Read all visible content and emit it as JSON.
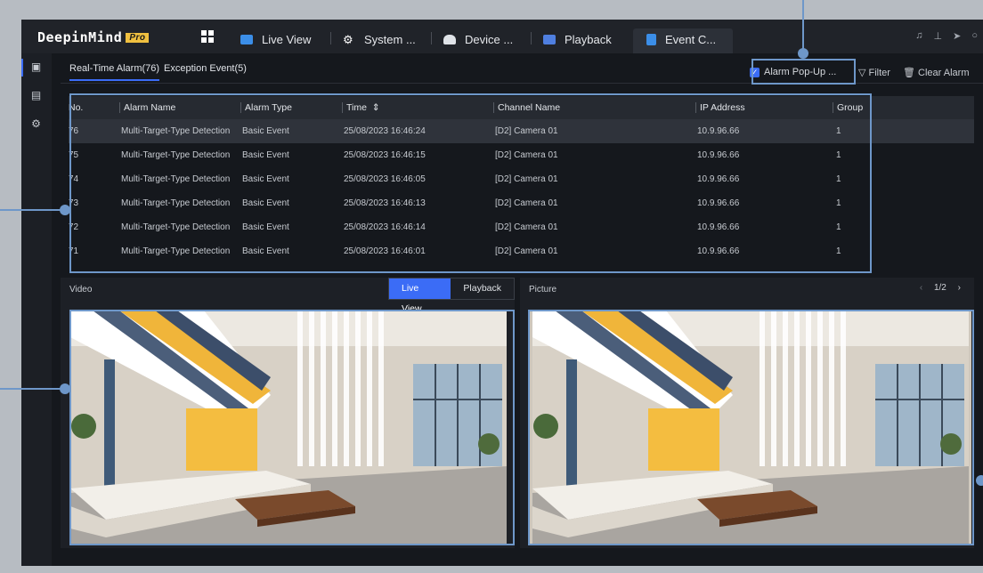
{
  "app": {
    "brand": "DeepinMind",
    "edition": "Pro"
  },
  "nav": {
    "tabs": [
      {
        "label": "Live View",
        "icon": "live-view-icon"
      },
      {
        "label": "System ...",
        "icon": "system-gear-icon"
      },
      {
        "label": "Device ...",
        "icon": "device-camera-icon"
      },
      {
        "label": "Playback",
        "icon": "playback-icon"
      },
      {
        "label": "Event C...",
        "icon": "event-center-icon",
        "active": true
      }
    ]
  },
  "subtabs": {
    "realtime": "Real-Time Alarm(76)",
    "exception": "Exception Event(5)"
  },
  "toolbar": {
    "alarm_popup": "Alarm Pop-Up ...",
    "filter": "Filter",
    "clear_alarm": "Clear Alarm"
  },
  "table": {
    "headers": {
      "no": "No.",
      "name": "Alarm Name",
      "type": "Alarm Type",
      "time": "Time",
      "channel": "Channel Name",
      "ip": "IP Address",
      "group": "Group"
    },
    "rows": [
      {
        "no": "76",
        "name": "Multi-Target-Type Detection",
        "type": "Basic Event",
        "time": "25/08/2023 16:46:24",
        "channel": "[D2] Camera 01",
        "ip": "10.9.96.66",
        "group": "1"
      },
      {
        "no": "75",
        "name": "Multi-Target-Type Detection",
        "type": "Basic Event",
        "time": "25/08/2023 16:46:15",
        "channel": "[D2] Camera 01",
        "ip": "10.9.96.66",
        "group": "1"
      },
      {
        "no": "74",
        "name": "Multi-Target-Type Detection",
        "type": "Basic Event",
        "time": "25/08/2023 16:46:05",
        "channel": "[D2] Camera 01",
        "ip": "10.9.96.66",
        "group": "1"
      },
      {
        "no": "73",
        "name": "Multi-Target-Type Detection",
        "type": "Basic Event",
        "time": "25/08/2023 16:46:13",
        "channel": "[D2] Camera 01",
        "ip": "10.9.96.66",
        "group": "1"
      },
      {
        "no": "72",
        "name": "Multi-Target-Type Detection",
        "type": "Basic Event",
        "time": "25/08/2023 16:46:14",
        "channel": "[D2] Camera 01",
        "ip": "10.9.96.66",
        "group": "1"
      },
      {
        "no": "71",
        "name": "Multi-Target-Type Detection",
        "type": "Basic Event",
        "time": "25/08/2023 16:46:01",
        "channel": "[D2] Camera 01",
        "ip": "10.9.96.66",
        "group": "1"
      }
    ]
  },
  "video": {
    "title": "Video",
    "live_view": "Live View",
    "playback": "Playback"
  },
  "picture": {
    "title": "Picture",
    "page": "1/2"
  },
  "colors": {
    "accent": "#3b6cf6",
    "callout": "#6e97c9"
  }
}
